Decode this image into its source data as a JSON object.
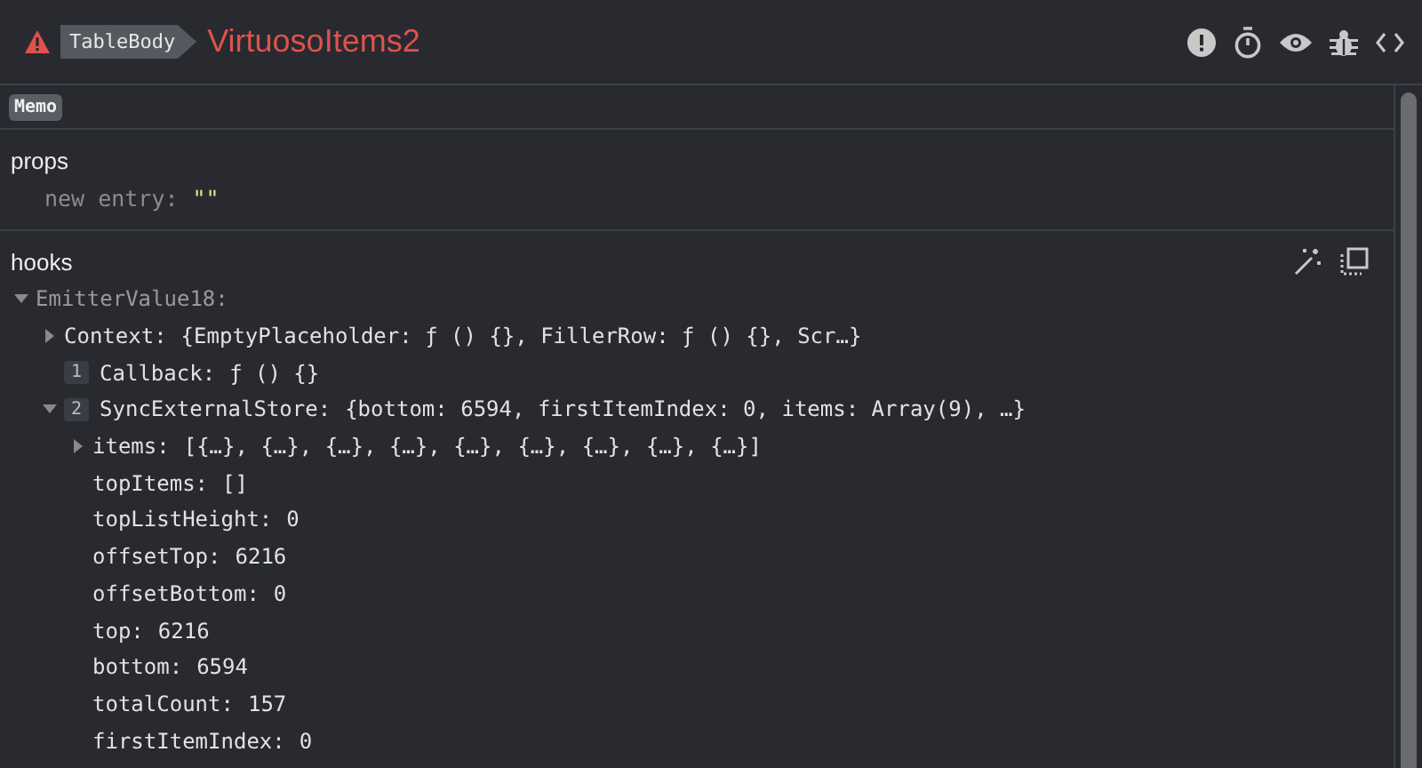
{
  "header": {
    "breadcrumb": "TableBody",
    "component": "VirtuosoItems2"
  },
  "badges": [
    "Memo"
  ],
  "props": {
    "title": "props",
    "entries": [
      {
        "key": "new entry:",
        "value": "\"\""
      }
    ]
  },
  "hooks": {
    "title": "hooks",
    "tree": [
      {
        "name": "EmitterValue18:",
        "expanded": true,
        "children": [
          {
            "name": "Context:",
            "value": "{EmptyPlaceholder: ƒ () {}, FillerRow: ƒ () {}, Scr…}",
            "expanded": false
          },
          {
            "index": "1",
            "name": "Callback:",
            "value": "ƒ () {}"
          },
          {
            "index": "2",
            "name": "SyncExternalStore:",
            "value": "{bottom: 6594, firstItemIndex: 0, items: Array(9), …}",
            "expanded": true,
            "children": [
              {
                "name": "items:",
                "value": "[{…}, {…}, {…}, {…}, {…}, {…}, {…}, {…}, {…}]",
                "expanded": false
              },
              {
                "name": "topItems:",
                "value": "[]"
              },
              {
                "name": "topListHeight:",
                "value": "0"
              },
              {
                "name": "offsetTop:",
                "value": "6216"
              },
              {
                "name": "offsetBottom:",
                "value": "0"
              },
              {
                "name": "top:",
                "value": "6216"
              },
              {
                "name": "bottom:",
                "value": "6594"
              },
              {
                "name": "totalCount:",
                "value": "157"
              },
              {
                "name": "firstItemIndex:",
                "value": "0"
              }
            ]
          }
        ]
      }
    ]
  }
}
